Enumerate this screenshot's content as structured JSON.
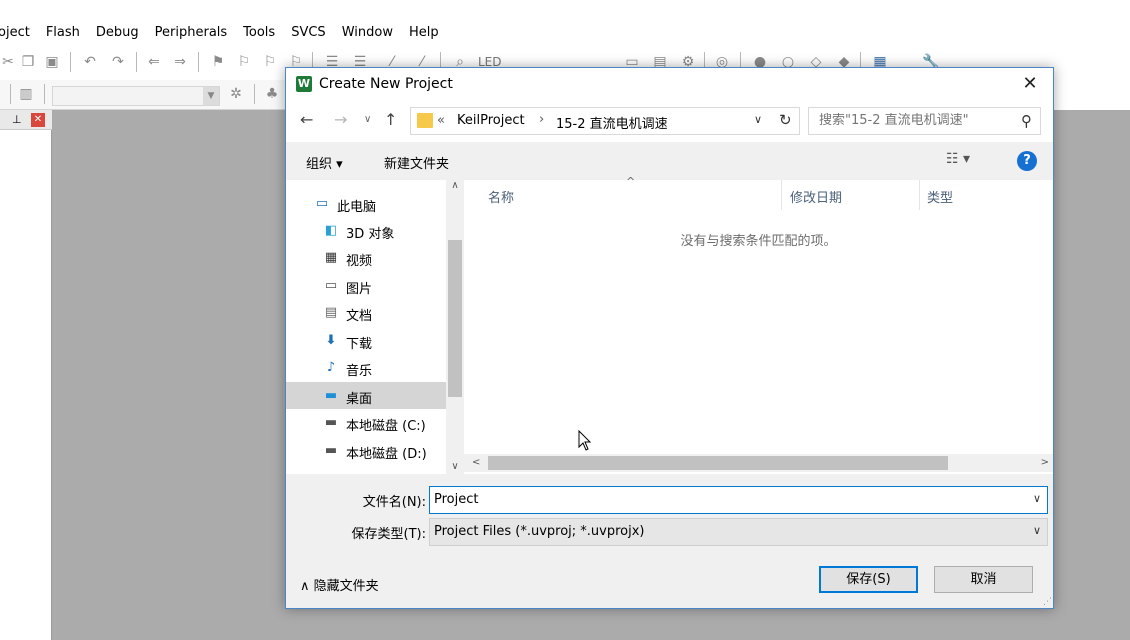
{
  "ide": {
    "menu": [
      "oject",
      "Flash",
      "Debug",
      "Peripherals",
      "Tools",
      "SVCS",
      "Window",
      "Help"
    ],
    "toolbar_target": "LED"
  },
  "dialog": {
    "title": "Create New Project",
    "address": {
      "overflow": "«",
      "segments": [
        "KeilProject",
        "15-2 直流电机调速"
      ],
      "separator": "›"
    },
    "search": {
      "placeholder": "搜索\"15-2 直流电机调速\""
    },
    "commands": {
      "organize": "组织 ▾",
      "new_folder": "新建文件夹"
    },
    "nav_tree": [
      {
        "label": "此电脑",
        "icon": "computer-icon"
      },
      {
        "label": "3D 对象",
        "icon": "3d-objects-icon"
      },
      {
        "label": "视频",
        "icon": "video-icon"
      },
      {
        "label": "图片",
        "icon": "pictures-icon"
      },
      {
        "label": "文档",
        "icon": "documents-icon"
      },
      {
        "label": "下载",
        "icon": "downloads-icon"
      },
      {
        "label": "音乐",
        "icon": "music-icon"
      },
      {
        "label": "桌面",
        "icon": "desktop-icon",
        "selected": true
      },
      {
        "label": "本地磁盘 (C:)",
        "icon": "drive-c-icon"
      },
      {
        "label": "本地磁盘 (D:)",
        "icon": "drive-d-icon"
      }
    ],
    "columns": {
      "name": "名称",
      "modified": "修改日期",
      "type": "类型"
    },
    "empty_message": "没有与搜索条件匹配的项。",
    "filename": {
      "label": "文件名(N):",
      "value": "Project"
    },
    "filetype": {
      "label": "保存类型(T):",
      "value": "Project Files (*.uvproj; *.uvprojx)"
    },
    "hide_folders": "∧ 隐藏文件夹",
    "save": "保存(S)",
    "cancel": "取消"
  },
  "colors": {
    "accent": "#0078d7",
    "help": "#1670d1",
    "folder": "#f6c94b"
  }
}
